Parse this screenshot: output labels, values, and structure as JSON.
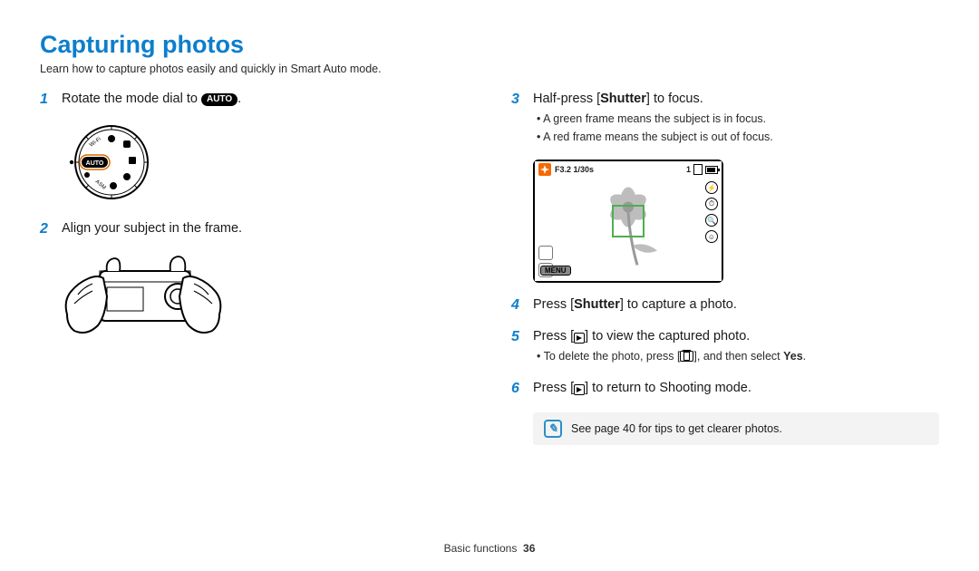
{
  "title": "Capturing photos",
  "subtitle": "Learn how to capture photos easily and quickly in Smart Auto mode.",
  "left": {
    "step1": {
      "num": "1",
      "pre": "Rotate the mode dial to ",
      "auto_label": "AUTO",
      "post": "."
    },
    "step2": {
      "num": "2",
      "text": "Align your subject in the frame."
    }
  },
  "right": {
    "step3": {
      "num": "3",
      "pre": "Half-press [",
      "bold": "Shutter",
      "post": "] to focus.",
      "bullets": [
        "A green frame means the subject is in focus.",
        "A red frame means the subject is out of focus."
      ]
    },
    "lcd": {
      "exposure": "F3.2 1/30s",
      "shots": "1",
      "menu": "MENU"
    },
    "step4": {
      "num": "4",
      "pre": "Press [",
      "bold": "Shutter",
      "post": "] to capture a photo."
    },
    "step5": {
      "num": "5",
      "pre": "Press [",
      "post": "] to view the captured photo.",
      "bullets_pre": "To delete the photo, press [",
      "bullets_mid": "], and then select ",
      "bullets_bold": "Yes",
      "bullets_post": "."
    },
    "step6": {
      "num": "6",
      "pre": "Press [",
      "post": "] to return to Shooting mode."
    },
    "tip": "See page 40 for tips to get clearer photos."
  },
  "dial": {
    "wifi": "Wi-Fi",
    "asm": "ASM",
    "auto": "AUTO"
  },
  "footer": {
    "section": "Basic functions",
    "page": "36"
  }
}
